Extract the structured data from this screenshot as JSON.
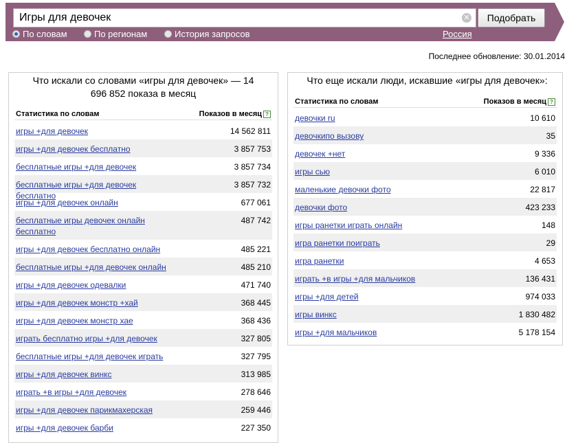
{
  "search": {
    "query": "Игры для девочек",
    "button_label": "Подобрать",
    "modes": [
      "По словам",
      "По регионам",
      "История запросов"
    ],
    "selected_mode": 0,
    "region": "Россия"
  },
  "last_update": "Последнее обновление: 30.01.2014",
  "left_panel": {
    "title": "Что искали со словами «игры для девочек» — 14 696 852 показа в месяц",
    "col_query": "Статистика по словам",
    "col_count": "Показов в месяц",
    "rows": [
      {
        "query": "игры +для девочек",
        "count": "14 562 811"
      },
      {
        "query": "игры +для девочек бесплатно",
        "count": "3 857 753"
      },
      {
        "query": "бесплатные игры +для девочек",
        "count": "3 857 734"
      },
      {
        "query": "бесплатные игры +для девочек бесплатно",
        "count": "3 857 732"
      },
      {
        "query": "игры +для девочек онлайн",
        "count": "677 061"
      },
      {
        "query": "бесплатные игры девочек онлайн бесплатно",
        "count": "487 742"
      },
      {
        "query": "игры +для девочек бесплатно онлайн",
        "count": "485 221"
      },
      {
        "query": "бесплатные игры +для девочек онлайн",
        "count": "485 210"
      },
      {
        "query": "игры +для девочек одевалки",
        "count": "471 740"
      },
      {
        "query": "игры +для девочек монстр +хай",
        "count": "368 445"
      },
      {
        "query": "игры +для девочек монстр хае",
        "count": "368 436"
      },
      {
        "query": "играть бесплатно игры +для девочек",
        "count": "327 805"
      },
      {
        "query": "бесплатные игры +для девочек играть",
        "count": "327 795"
      },
      {
        "query": "игры +для девочек винкс",
        "count": "313 985"
      },
      {
        "query": "играть +в игры +для девочек",
        "count": "278 646"
      },
      {
        "query": "игры +для девочек парикмахерская",
        "count": "259 446"
      },
      {
        "query": "игры +для девочек барби",
        "count": "227 350"
      }
    ]
  },
  "right_panel": {
    "title": "Что еще искали люди, искавшие «игры для девочек»:",
    "col_query": "Статистика по словам",
    "col_count": "Показов в месяц",
    "rows": [
      {
        "query": "девочки ru",
        "count": "10 610"
      },
      {
        "query": "девочкипо вызову",
        "count": "35"
      },
      {
        "query": "девочек +нет",
        "count": "9 336"
      },
      {
        "query": "игры сью",
        "count": "6 010"
      },
      {
        "query": "маленькие девочки фото",
        "count": "22 817"
      },
      {
        "query": "девочки фото",
        "count": "423 233"
      },
      {
        "query": "игры ранетки играть онлайн",
        "count": "148"
      },
      {
        "query": "игра ранетки поиграть",
        "count": "29"
      },
      {
        "query": "игра ранетки",
        "count": "4 653"
      },
      {
        "query": "играть +в игры +для мальчиков",
        "count": "136 431"
      },
      {
        "query": "игры +для детей",
        "count": "974 033"
      },
      {
        "query": "игры винкс",
        "count": "1 830 482"
      },
      {
        "query": "игры +для мальчиков",
        "count": "5 178 154"
      }
    ]
  }
}
